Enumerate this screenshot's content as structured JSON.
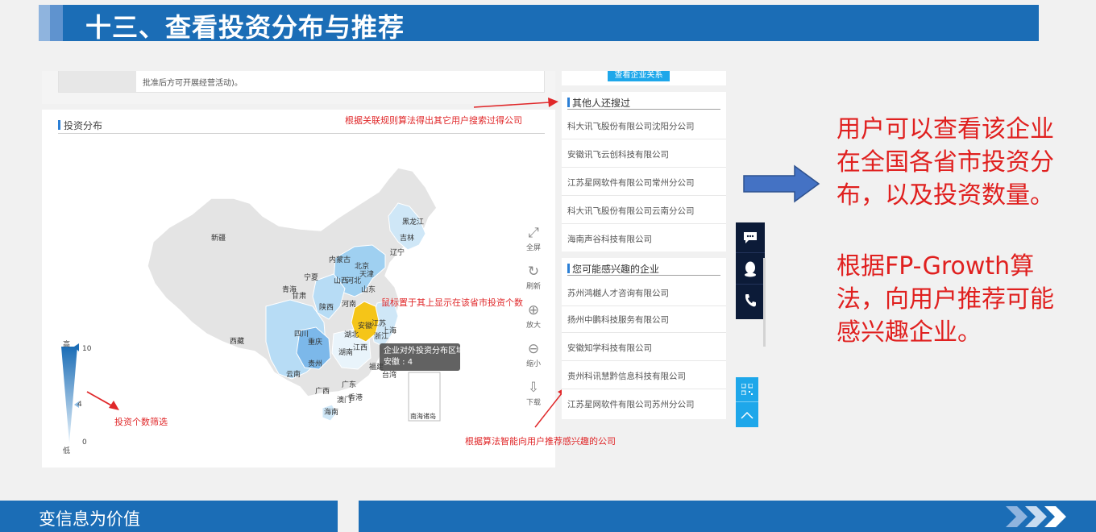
{
  "slide": {
    "title": "十三、查看投资分布与推荐",
    "footer_text": "变信息为价值"
  },
  "company_card": {
    "scope_text_line2": "批准后方可开展经营活动)。",
    "relation_button": "查看企业关系"
  },
  "investment": {
    "section_title": "投资分布",
    "tooltip_title": "企业对外投资分布区域",
    "tooltip_value": "安徽 : 4",
    "legend": {
      "high": "高",
      "low": "低",
      "max": "10",
      "mid": "4",
      "min": "0"
    },
    "highlighted_province": "安徽",
    "highlight_color": "#f5c518",
    "island_label": "南海诸岛"
  },
  "provinces": [
    "黑龙江",
    "吉林",
    "辽宁",
    "内蒙古",
    "北京",
    "天津",
    "河北",
    "宁夏",
    "山西",
    "山东",
    "青海",
    "甘肃",
    "陕西",
    "河南",
    "江苏",
    "安徽",
    "上海",
    "湖北",
    "浙江",
    "新疆",
    "西藏",
    "四川",
    "重庆",
    "贵州",
    "湖南",
    "江西",
    "福建",
    "台湾",
    "云南",
    "广西",
    "广东",
    "澳门",
    "香港",
    "海南"
  ],
  "toolbox": {
    "fullscreen": "全屏",
    "refresh": "刷新",
    "zoom_in": "放大",
    "zoom_out": "缩小",
    "download": "下载"
  },
  "annotations": {
    "assoc_rule": "根据关联规则算法得出其它用户搜索过得公司",
    "hover_tip": "鼠标置于其上显示在该省市投资个数",
    "filter_tip": "投资个数筛选",
    "recommend_tip": "根据算法智能向用户推荐感兴趣的公司"
  },
  "others_searched": {
    "title": "其他人还搜过",
    "items": [
      "科大讯飞股份有限公司沈阳分公司",
      "安徽讯飞云创科技有限公司",
      "江苏星网软件有限公司常州分公司",
      "科大讯飞股份有限公司云南分公司",
      "海南声谷科技有限公司"
    ]
  },
  "may_interest": {
    "title": "您可能感兴趣的企业",
    "items": [
      "苏州鸿樾人才咨询有限公司",
      "扬州中鹏科技服务有限公司",
      "安徽知学科技有限公司",
      "贵州科讯慧黔信息科技有限公司",
      "江苏星网软件有限公司苏州分公司"
    ]
  },
  "side_buttons": [
    "chat-icon",
    "qq-icon",
    "phone-icon"
  ],
  "description": {
    "para1": "用户可以查看该企业在全国各省市投资分布，以及投资数量。",
    "para2": "根据FP-Growth算法，向用户推荐可能感兴趣企业。"
  },
  "colors": {
    "primary_blue": "#1b6db6",
    "annotation_red": "#e0282a",
    "accent_cyan": "#1ea7ea"
  }
}
